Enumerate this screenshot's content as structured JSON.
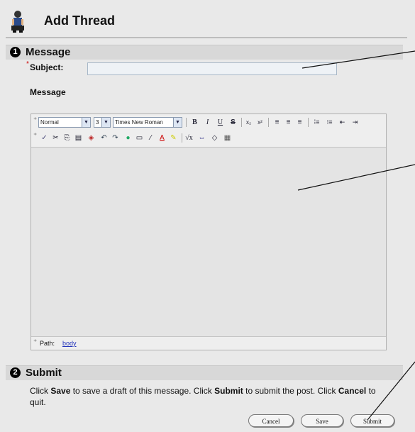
{
  "header": {
    "title": "Add Thread",
    "icon": "user-figure-icon"
  },
  "message_section": {
    "number": "1",
    "title": "Message"
  },
  "subject": {
    "required_mark": "*",
    "label": "Subject:",
    "value": ""
  },
  "message_label": "Message",
  "editor": {
    "style_value": "Normal",
    "size_value": "3",
    "font_value": "Times New Roman",
    "path_label": "Path:",
    "path_link": "body"
  },
  "submit_section": {
    "number": "2",
    "title": "Submit",
    "text_1": "Click ",
    "bold_save": "Save",
    "text_2": " to save a draft of this message. Click ",
    "bold_submit": "Submit",
    "text_3": " to submit the post. Click ",
    "bold_cancel": "Cancel",
    "text_4": " to quit."
  },
  "buttons": {
    "cancel": "Cancel",
    "save": "Save",
    "submit": "Submit"
  }
}
